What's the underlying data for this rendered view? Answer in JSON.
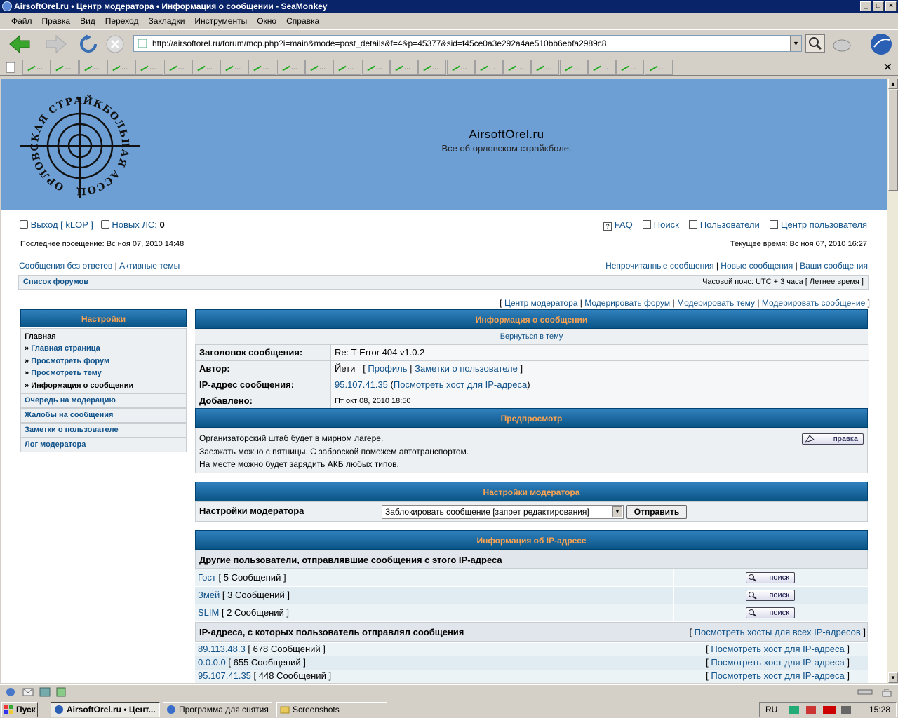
{
  "window": {
    "title": "AirsoftOrel.ru • Центр модератора • Информация о сообщении - SeaMonkey"
  },
  "menu": [
    "Файл",
    "Правка",
    "Вид",
    "Переход",
    "Закладки",
    "Инструменты",
    "Окно",
    "Справка"
  ],
  "url": "http://airsoftorel.ru/forum/mcp.php?i=main&mode=post_details&f=4&p=45377&sid=f45ce0a3e292a4ae510bb6ebfa2989c8",
  "tabs_label": "...",
  "site": {
    "title": "AirsoftOrel.ru",
    "desc": "Все об орловском страйкболе.",
    "logo_text": "ОРЛОВСКАЯ СТРАЙКБОЛЬНАЯ АССОЦИАЦИЯ"
  },
  "user": {
    "logout": "Выход [ kLOP ]",
    "pm_label": "Новых ЛС:",
    "pm_count": "0",
    "last_visit": "Последнее посещение: Вс ноя 07, 2010 14:48",
    "current_time": "Текущее время: Вс ноя 07, 2010 16:27"
  },
  "toplinks": {
    "faq": "FAQ",
    "search": "Поиск",
    "members": "Пользователи",
    "ucp": "Центр пользователя"
  },
  "quicklinks": {
    "unanswered": "Сообщения без ответов",
    "active": "Активные темы",
    "unread": "Непрочитанные сообщения",
    "new": "Новые сообщения",
    "yours": "Ваши сообщения",
    "sep": "|"
  },
  "breadcrumb": {
    "forums": "Список форумов",
    "tz": "Часовой пояс: UTC + 3 часа [ Летнее время ]"
  },
  "mcp_links": {
    "mcp": "Центр модератора",
    "forum": "Модерировать форум",
    "topic": "Модерировать тему",
    "post": "Модерировать сообщение",
    "lb": "[",
    "rb": "]"
  },
  "sidebar": {
    "title": "Настройки",
    "main": "Главная",
    "items": [
      "Главная страница",
      "Просмотреть форум",
      "Просмотреть тему",
      "Информация о сообщении"
    ],
    "links": [
      "Очередь на модерацию",
      "Жалобы на сообщения",
      "Заметки о пользователе",
      "Лог модератора"
    ],
    "bullet": "»"
  },
  "post": {
    "header": "Информация о сообщении",
    "back": "Вернуться в тему",
    "subject_label": "Заголовок сообщения:",
    "subject": "Re: T-Error 404 v1.0.2",
    "author_label": "Автор:",
    "author": "Йети",
    "profile": "Профиль",
    "notes": "Заметки о пользователе",
    "ip_label": "IP-адрес сообщения:",
    "ip": "95.107.41.35",
    "whois": "Посмотреть хост для IP-адреса",
    "added_label": "Добавлено:",
    "added": "Пт окт 08, 2010 18:50"
  },
  "preview": {
    "header": "Предпросмотр",
    "lines": [
      "Организаторский штаб будет в мирном лагере.",
      "Заезжать можно с пятницы. С заброской поможем автотранспортом.",
      "На месте можно будет зарядить АКБ любых типов."
    ],
    "edit": "правка"
  },
  "modopts": {
    "header": "Настройки модератора",
    "label": "Настройки модератора",
    "select": "Заблокировать сообщение [запрет редактирования]",
    "submit": "Отправить"
  },
  "ipinfo": {
    "header": "Информация об IP-адресе",
    "others": "Другие пользователи, отправлявшие сообщения с этого IP-адреса",
    "users": [
      {
        "name": "Гост",
        "count": "[ 5 Сообщений ]"
      },
      {
        "name": "Змей",
        "count": "[ 3 Сообщений ]"
      },
      {
        "name": "SLIM",
        "count": "[ 2 Сообщений ]"
      }
    ],
    "search": "поиск",
    "ips_title": "IP-адреса, с которых пользователь отправлял сообщения",
    "lookup_all": "Посмотреть хосты для всех IP-адресов",
    "ips": [
      {
        "ip": "89.113.48.3",
        "count": "[ 678 Сообщений ]"
      },
      {
        "ip": "0.0.0.0",
        "count": "[ 655 Сообщений ]"
      },
      {
        "ip": "95.107.41.35",
        "count": "[ 448 Сообщений ]"
      }
    ],
    "lookup": "Посмотреть хост для IP-адреса"
  },
  "taskbar": {
    "start": "Пуск",
    "tasks": [
      "AirsoftOrel.ru • Цент...",
      "Программа для снятия ...",
      "Screenshots"
    ],
    "lang": "RU",
    "clock": "15:28"
  }
}
